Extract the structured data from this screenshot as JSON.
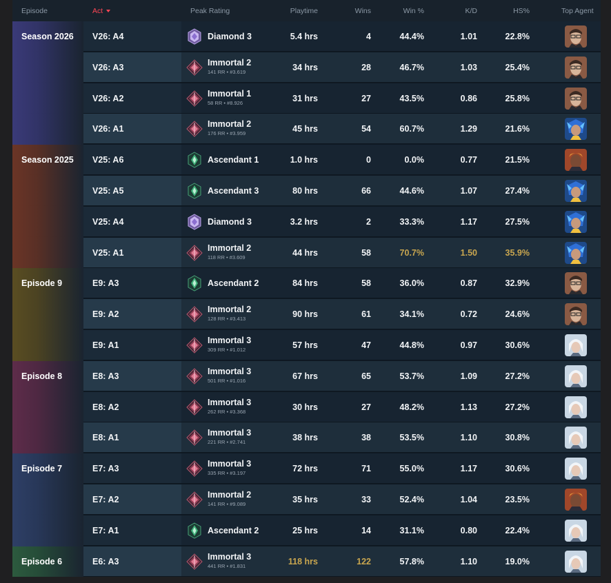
{
  "headers": {
    "episode": "Episode",
    "act": "Act",
    "peak_rating": "Peak Rating",
    "playtime": "Playtime",
    "wins": "Wins",
    "win_pct": "Win %",
    "kd": "K/D",
    "hs_pct": "HS%",
    "top_agent": "Top Agent"
  },
  "sort": {
    "column": "act",
    "direction": "descending"
  },
  "colors": {
    "accent": "#ff4655",
    "highlight": "#c9a64f"
  },
  "groups": [
    {
      "label": "Season 2026",
      "rows": 4,
      "color": "#3a3a78"
    },
    {
      "label": "Season 2025",
      "rows": 4,
      "color": "#6b3526"
    },
    {
      "label": "Episode 9",
      "rows": 3,
      "color": "#5a4d22"
    },
    {
      "label": "Episode 8",
      "rows": 3,
      "color": "#5e2c4a"
    },
    {
      "label": "Episode 7",
      "rows": 3,
      "color": "#2e3f66"
    },
    {
      "label": "Episode 6",
      "rows": 1,
      "color": "#2c5a3e"
    }
  ],
  "rows": [
    {
      "act": "V26: A4",
      "rank": "Diamond 3",
      "rank_icon": "diamond-rank-icon",
      "rr": "",
      "playtime": "5.4 hrs",
      "wins": "4",
      "win": "44.4%",
      "kd": "1.01",
      "hs": "22.8%",
      "agent": "chamber-agent-icon",
      "hl": []
    },
    {
      "act": "V26: A3",
      "rank": "Immortal 2",
      "rank_icon": "immortal-rank-icon",
      "rr": "141 RR • #3.619",
      "playtime": "34 hrs",
      "wins": "28",
      "win": "46.7%",
      "kd": "1.03",
      "hs": "25.4%",
      "agent": "chamber-agent-icon",
      "hl": []
    },
    {
      "act": "V26: A2",
      "rank": "Immortal 1",
      "rank_icon": "immortal-rank-icon",
      "rr": "58 RR • #8.926",
      "playtime": "31 hrs",
      "wins": "27",
      "win": "43.5%",
      "kd": "0.86",
      "hs": "25.8%",
      "agent": "chamber-agent-icon",
      "hl": []
    },
    {
      "act": "V26: A1",
      "rank": "Immortal 2",
      "rank_icon": "immortal-rank-icon",
      "rr": "176 RR • #3.959",
      "playtime": "45 hrs",
      "wins": "54",
      "win": "60.7%",
      "kd": "1.29",
      "hs": "21.6%",
      "agent": "neon-agent-icon",
      "hl": []
    },
    {
      "act": "V25: A6",
      "rank": "Ascendant 1",
      "rank_icon": "ascendant-rank-icon",
      "rr": "",
      "playtime": "1.0 hrs",
      "wins": "0",
      "win": "0.0%",
      "kd": "0.77",
      "hs": "21.5%",
      "agent": "phoenix-agent-icon",
      "hl": []
    },
    {
      "act": "V25: A5",
      "rank": "Ascendant 3",
      "rank_icon": "ascendant-rank-icon",
      "rr": "",
      "playtime": "80 hrs",
      "wins": "66",
      "win": "44.6%",
      "kd": "1.07",
      "hs": "27.4%",
      "agent": "neon-agent-icon",
      "hl": []
    },
    {
      "act": "V25: A4",
      "rank": "Diamond 3",
      "rank_icon": "diamond-rank-icon",
      "rr": "",
      "playtime": "3.2 hrs",
      "wins": "2",
      "win": "33.3%",
      "kd": "1.17",
      "hs": "27.5%",
      "agent": "neon-agent-icon",
      "hl": []
    },
    {
      "act": "V25: A1",
      "rank": "Immortal 2",
      "rank_icon": "immortal-rank-icon",
      "rr": "118 RR • #3.609",
      "playtime": "44 hrs",
      "wins": "58",
      "win": "70.7%",
      "kd": "1.50",
      "hs": "35.9%",
      "agent": "neon-agent-icon",
      "hl": [
        "win",
        "kd",
        "hs"
      ]
    },
    {
      "act": "E9: A3",
      "rank": "Ascendant 2",
      "rank_icon": "ascendant-rank-icon",
      "rr": "",
      "playtime": "84 hrs",
      "wins": "58",
      "win": "36.0%",
      "kd": "0.87",
      "hs": "32.9%",
      "agent": "chamber-agent-icon",
      "hl": []
    },
    {
      "act": "E9: A2",
      "rank": "Immortal 2",
      "rank_icon": "immortal-rank-icon",
      "rr": "128 RR • #3.413",
      "playtime": "90 hrs",
      "wins": "61",
      "win": "34.1%",
      "kd": "0.72",
      "hs": "24.6%",
      "agent": "chamber-agent-icon",
      "hl": []
    },
    {
      "act": "E9: A1",
      "rank": "Immortal 3",
      "rank_icon": "immortal-rank-icon",
      "rr": "309 RR • #1.012",
      "playtime": "57 hrs",
      "wins": "47",
      "win": "44.8%",
      "kd": "0.97",
      "hs": "30.6%",
      "agent": "jett-agent-icon",
      "hl": []
    },
    {
      "act": "E8: A3",
      "rank": "Immortal 3",
      "rank_icon": "immortal-rank-icon",
      "rr": "501 RR • #1.016",
      "playtime": "67 hrs",
      "wins": "65",
      "win": "53.7%",
      "kd": "1.09",
      "hs": "27.2%",
      "agent": "jett-agent-icon",
      "hl": []
    },
    {
      "act": "E8: A2",
      "rank": "Immortal 3",
      "rank_icon": "immortal-rank-icon",
      "rr": "262 RR • #3.368",
      "playtime": "30 hrs",
      "wins": "27",
      "win": "48.2%",
      "kd": "1.13",
      "hs": "27.2%",
      "agent": "jett-agent-icon",
      "hl": []
    },
    {
      "act": "E8: A1",
      "rank": "Immortal 3",
      "rank_icon": "immortal-rank-icon",
      "rr": "221 RR • #2.741",
      "playtime": "38 hrs",
      "wins": "38",
      "win": "53.5%",
      "kd": "1.10",
      "hs": "30.8%",
      "agent": "jett-agent-icon",
      "hl": []
    },
    {
      "act": "E7: A3",
      "rank": "Immortal 3",
      "rank_icon": "immortal-rank-icon",
      "rr": "335 RR • #3.197",
      "playtime": "72 hrs",
      "wins": "71",
      "win": "55.0%",
      "kd": "1.17",
      "hs": "30.6%",
      "agent": "jett-agent-icon",
      "hl": []
    },
    {
      "act": "E7: A2",
      "rank": "Immortal 2",
      "rank_icon": "immortal-rank-icon",
      "rr": "141 RR • #9.089",
      "playtime": "35 hrs",
      "wins": "33",
      "win": "52.4%",
      "kd": "1.04",
      "hs": "23.5%",
      "agent": "phoenix-agent-icon",
      "hl": []
    },
    {
      "act": "E7: A1",
      "rank": "Ascendant 2",
      "rank_icon": "ascendant-rank-icon",
      "rr": "",
      "playtime": "25 hrs",
      "wins": "14",
      "win": "31.1%",
      "kd": "0.80",
      "hs": "22.4%",
      "agent": "jett-agent-icon",
      "hl": []
    },
    {
      "act": "E6: A3",
      "rank": "Immortal 3",
      "rank_icon": "immortal-rank-icon",
      "rr": "441 RR • #1.831",
      "playtime": "118 hrs",
      "wins": "122",
      "win": "57.8%",
      "kd": "1.10",
      "hs": "19.0%",
      "agent": "jett-agent-icon",
      "hl": [
        "playtime",
        "wins"
      ]
    }
  ]
}
